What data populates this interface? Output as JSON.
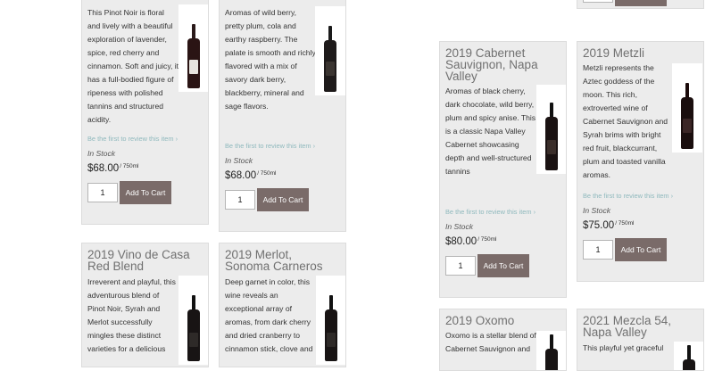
{
  "common": {
    "review_text": "Be the first to review this item ›",
    "stock_text": "In Stock",
    "unit_text": "/ 750ml",
    "qty_value": "1",
    "cart_label": "Add To Cart"
  },
  "products": [
    {
      "title": "",
      "description": [
        "This Pinot Noir is floral",
        "and lively with a beautiful",
        "exploration of lavender,",
        "spice, red cherry and",
        "cinnamon. Soft and juicy, it",
        "has a full-bodied figure of",
        "ripeness with polished",
        "tannins and structured",
        "acidity."
      ],
      "price": "$68.00"
    },
    {
      "title": "",
      "description": [
        "Aromas of wild berry,",
        "pretty plum, cola and",
        "earthy raspberry. The",
        "palate is smooth and richly",
        "flavored with a mix of",
        "savory dark berry,",
        "blackberry, mineral and",
        "sage flavors."
      ],
      "price": "$68.00"
    },
    {
      "title_lines": [
        "2019 Cabernet",
        "Sauvignon, Napa",
        "Valley"
      ],
      "description": [
        "Aromas of black cherry,",
        "dark chocolate, wild berry,",
        "plum and spicy anise. This",
        "is a classic Napa Valley",
        "Cabernet showcasing",
        "depth and well-structured",
        "tannins"
      ],
      "price": "$80.00"
    },
    {
      "title_lines": [
        "2019 Metzli"
      ],
      "description": [
        "Metzli represents the",
        "Aztec goddess of the",
        "moon. This rich,",
        "extroverted wine of",
        "Cabernet Sauvignon and",
        "Syrah brims with bright",
        "red fruit, blackcurrant,",
        "plum and toasted vanilla",
        "aromas."
      ],
      "price": "$75.00"
    },
    {
      "title_lines": [
        "2019 Vino de Casa",
        "Red Blend"
      ],
      "description": [
        "Irreverent and playful, this",
        "adventurous blend of",
        "Pinot Noir, Syrah and",
        "Merlot successfully",
        "mingles these distinct",
        "varieties for a delicious"
      ]
    },
    {
      "title_lines": [
        "2019 Merlot,",
        "Sonoma Carneros"
      ],
      "description": [
        "Deep garnet in color, this",
        "wine reveals an",
        "exceptional array of",
        "aromas, from dark cherry",
        "and dried cranberry to",
        "cinnamon stick, clove and"
      ]
    },
    {
      "title_lines": [
        "2019 Oxomo"
      ],
      "description": [
        "Oxomo is a stellar blend of",
        "Cabernet Sauvignon and"
      ]
    },
    {
      "title_lines": [
        "2021 Mezcla 54,",
        "Napa Valley"
      ],
      "description": [
        "This playful yet graceful"
      ]
    }
  ]
}
